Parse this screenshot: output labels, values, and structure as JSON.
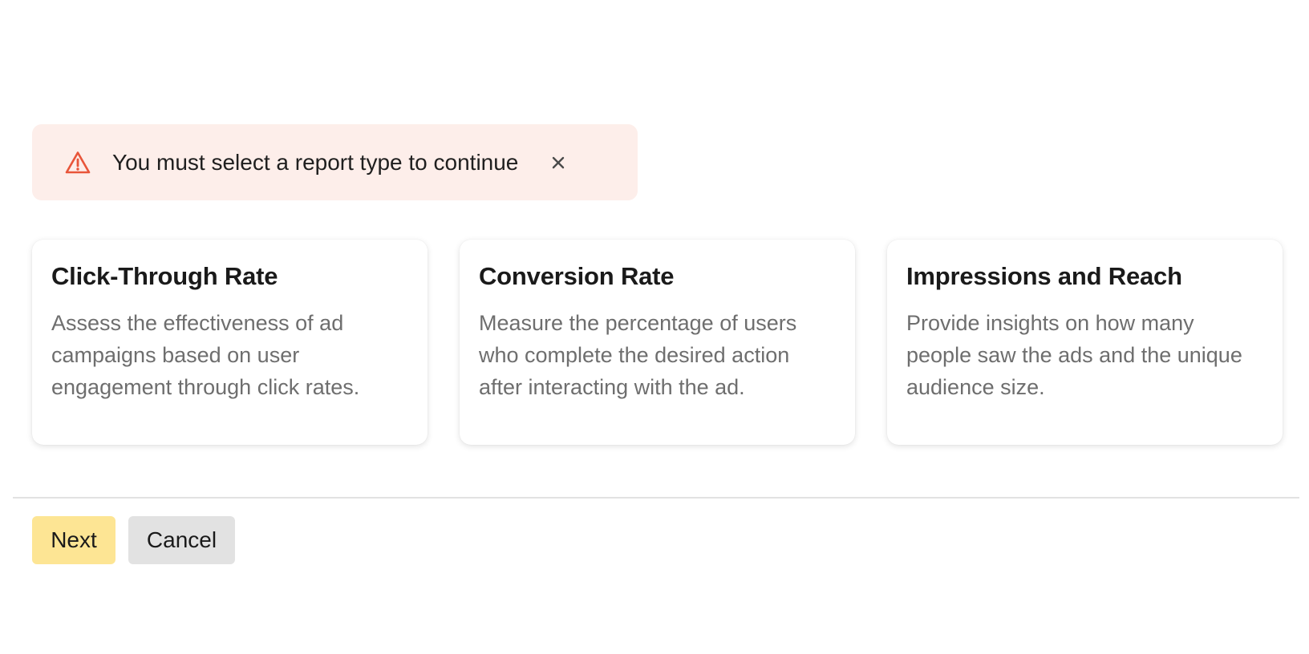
{
  "alert": {
    "message": "You must select a report type to continue",
    "icon": "warning-triangle-icon",
    "close_icon": "close-icon",
    "color": "#e8553a",
    "background": "#fdeeea"
  },
  "cards": [
    {
      "title": "Click-Through Rate",
      "description": "Assess the effectiveness of ad campaigns based on user engagement through click rates."
    },
    {
      "title": "Conversion Rate",
      "description": "Measure the percentage of users who complete the desired action after interacting with the ad."
    },
    {
      "title": "Impressions and Reach",
      "description": "Provide insights on how many people saw the ads and the unique audience size."
    }
  ],
  "actions": {
    "next_label": "Next",
    "cancel_label": "Cancel",
    "next_color": "#fde594",
    "cancel_color": "#e2e2e2"
  }
}
